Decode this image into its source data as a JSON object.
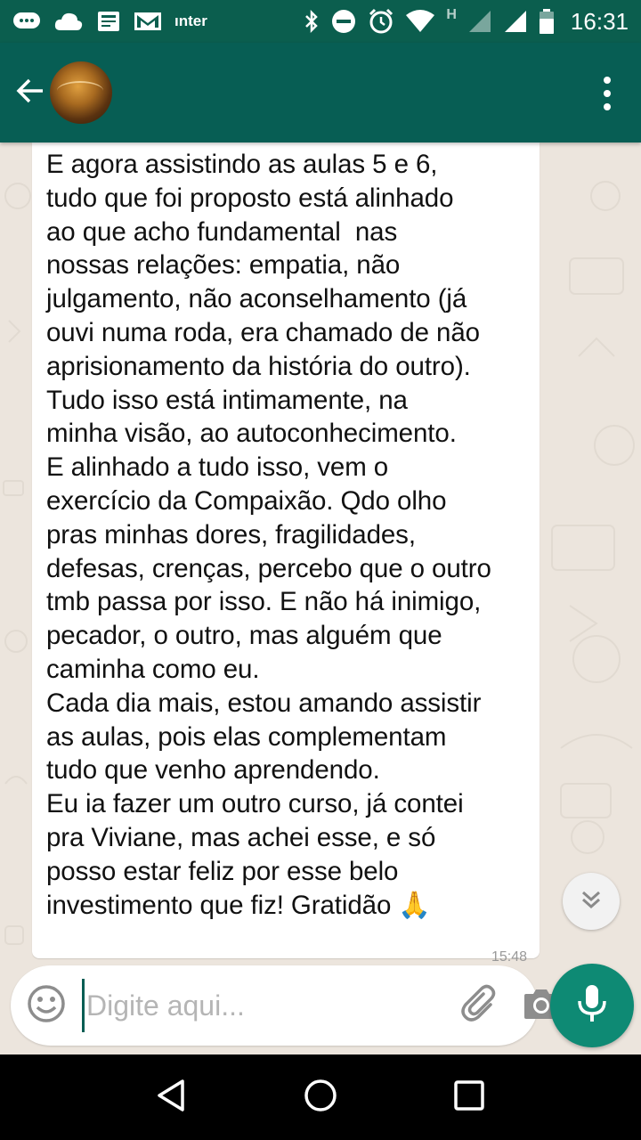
{
  "status_bar": {
    "carrier_text": "ınter",
    "network_letter": "H",
    "time": "16:31",
    "icons": [
      "chat-notification-icon",
      "cloud-icon",
      "news-icon",
      "gmail-icon",
      "bluetooth-icon",
      "do-not-disturb-icon",
      "alarm-icon",
      "wifi-icon",
      "signal-icon",
      "signal-icon",
      "battery-icon"
    ]
  },
  "header": {
    "back_icon": "arrow-left-icon",
    "avatar": "contact-avatar",
    "menu_icon": "more-vertical-icon",
    "colors": {
      "app_bar": "#075e54",
      "status_bar": "#0b5e4e"
    }
  },
  "chat": {
    "message_text": "E agora assistindo as aulas 5 e 6,\ntudo que foi proposto está alinhado\nao que acho fundamental  nas\nnossas relações: empatia, não\njulgamento, não aconselhamento (já\nouvi numa roda, era chamado de não\naprisionamento da história do outro).\nTudo isso está intimamente, na\nminha visão, ao autoconhecimento.\nE alinhado a tudo isso, vem o\nexercício da Compaixão. Qdo olho\npras minhas dores, fragilidades,\ndefesas, crenças, percebo que o outro\ntmb passa por isso. E não há inimigo,\npecador, o outro, mas alguém que\ncaminha como eu.\nCada dia mais, estou amando assistir\nas aulas, pois elas complementam\ntudo que venho aprendendo.\nEu ia fazer um outro curso, já contei\npra Viviane, mas achei esse, e só\nposso estar feliz por esse belo\ninvestimento que fiz! Gratidão 🙏",
    "message_time": "15:48",
    "scroll_icon": "double-chevron-down-icon"
  },
  "input_bar": {
    "placeholder": "Digite aqui...",
    "emoji_icon": "emoji-icon",
    "attach_icon": "paperclip-icon",
    "camera_icon": "camera-icon",
    "mic_icon": "microphone-icon",
    "colors": {
      "mic_button": "#0e8a74"
    }
  },
  "nav_bar": {
    "icons": [
      "back-triangle-icon",
      "home-circle-icon",
      "recents-square-icon"
    ]
  }
}
